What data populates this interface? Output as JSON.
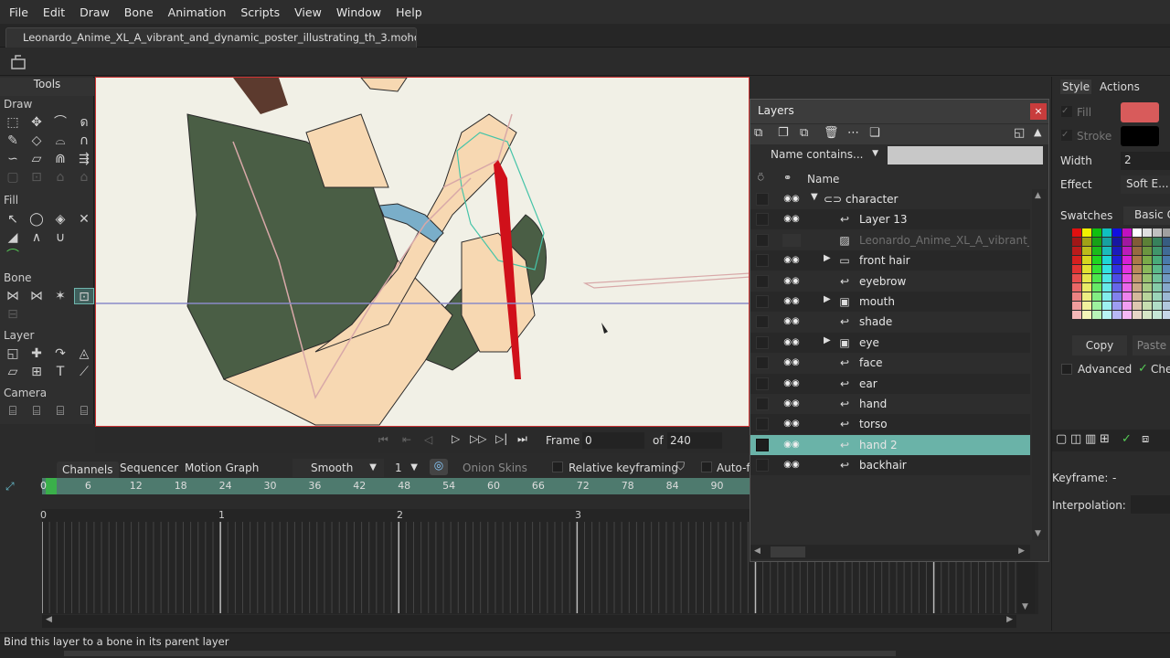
{
  "menu": [
    "File",
    "Edit",
    "Draw",
    "Bone",
    "Animation",
    "Scripts",
    "View",
    "Window",
    "Help"
  ],
  "document_tab": "Leonardo_Anime_XL_A_vibrant_and_dynamic_poster_illustrating_th_3.moho",
  "tools": {
    "title": "Tools",
    "sections": {
      "draw": "Draw",
      "fill": "Fill",
      "bone": "Bone",
      "layer": "Layer",
      "camera": "Camera"
    }
  },
  "playback": {
    "frame_label": "Frame",
    "frame_value": "0",
    "of_label": "of",
    "total": "240"
  },
  "timeline": {
    "tabs": [
      "Channels",
      "Sequencer",
      "Motion Graph"
    ],
    "interpolation": "Smooth",
    "step": "1",
    "onion_skins": "Onion Skins",
    "relative_keyframing": "Relative keyframing",
    "auto": "Auto-f",
    "ruler_ticks": [
      "0",
      "6",
      "12",
      "18",
      "24",
      "30",
      "36",
      "42",
      "48",
      "54",
      "60",
      "66",
      "72",
      "78",
      "84",
      "90"
    ],
    "seconds": [
      "0",
      "1",
      "2",
      "3"
    ]
  },
  "layers_panel": {
    "title": "Layers",
    "filter": "Name contains...",
    "column_name": "Name",
    "rows": [
      {
        "name": "character",
        "icon": "bone",
        "expanded": true,
        "selected": false,
        "dim": false
      },
      {
        "name": "Layer 13",
        "icon": "vector",
        "selected": false,
        "dim": false
      },
      {
        "name": "Leonardo_Anime_XL_A_vibrant_and",
        "icon": "image",
        "selected": false,
        "dim": true
      },
      {
        "name": "front hair",
        "icon": "group",
        "collapsed": true,
        "selected": false,
        "dim": false
      },
      {
        "name": "eyebrow",
        "icon": "vector",
        "selected": false,
        "dim": false
      },
      {
        "name": "mouth",
        "icon": "switch",
        "collapsed": true,
        "selected": false,
        "dim": false
      },
      {
        "name": "shade",
        "icon": "vector",
        "selected": false,
        "dim": false
      },
      {
        "name": "eye",
        "icon": "switch",
        "collapsed": true,
        "selected": false,
        "dim": false
      },
      {
        "name": "face",
        "icon": "vector",
        "selected": false,
        "dim": false
      },
      {
        "name": "ear",
        "icon": "vector",
        "selected": false,
        "dim": false
      },
      {
        "name": "hand",
        "icon": "vector",
        "selected": false,
        "dim": false
      },
      {
        "name": "torso",
        "icon": "vector",
        "selected": false,
        "dim": false
      },
      {
        "name": "hand 2",
        "icon": "vector",
        "selected": true,
        "dim": false
      },
      {
        "name": "backhair",
        "icon": "vector",
        "selected": false,
        "dim": false
      }
    ],
    "selected_color": "#6ab3a8"
  },
  "right_panel": {
    "tabs": [
      "Style",
      "Actions"
    ],
    "fill_label": "Fill",
    "fill_color": "#d85b5b",
    "stroke_label": "Stroke",
    "stroke_color": "#000000",
    "width_label": "Width",
    "width_value": "2",
    "effect_label": "Effect",
    "effect_value": "Soft E...",
    "swatches_label": "Swatches",
    "swatches_set": "Basic C",
    "copy": "Copy",
    "paste": "Paste",
    "advanced": "Advanced",
    "check_label": "Che",
    "keyframe_label": "Keyframe:",
    "keyframe_value": "-",
    "interpolation_label": "Interpolation:"
  },
  "status": "Bind this layer to a bone in its parent layer"
}
